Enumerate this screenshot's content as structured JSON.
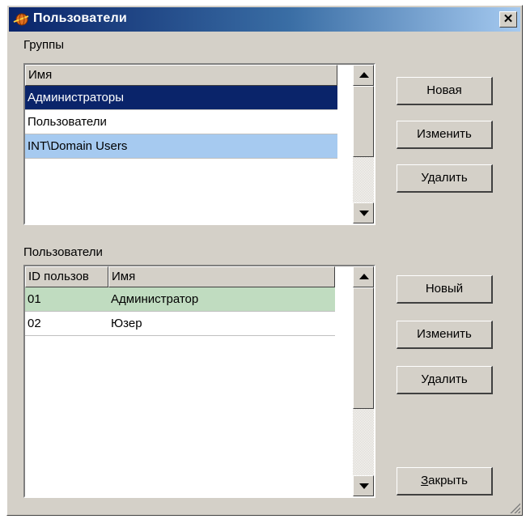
{
  "window": {
    "title": "Пользователи",
    "close_symbol": "✕"
  },
  "colors": {
    "selected_bg": "#0a246a",
    "selected_text": "#ffffff",
    "light_blue_bg": "#a6caf0",
    "light_green_bg": "#c0dcc0"
  },
  "groups": {
    "label": "Группы",
    "header": {
      "name": "Имя"
    },
    "rows": [
      {
        "name": "Администраторы",
        "state": "selected"
      },
      {
        "name": "Пользователи",
        "state": "normal"
      },
      {
        "name": "INT\\Domain Users",
        "state": "highlight"
      }
    ],
    "buttons": {
      "new": "Новая",
      "edit": "Изменить",
      "delete": "Удалить"
    }
  },
  "users": {
    "label": "Пользователи",
    "header": {
      "id": "ID пользов",
      "name": "Имя"
    },
    "rows": [
      {
        "id": "01",
        "name": "Администратор",
        "state": "green"
      },
      {
        "id": "02",
        "name": "Юзер",
        "state": "normal"
      }
    ],
    "buttons": {
      "new": "Новый",
      "edit": "Изменить",
      "delete": "Удалить"
    }
  },
  "close_button": {
    "accel": "З",
    "rest": "акрыть"
  }
}
